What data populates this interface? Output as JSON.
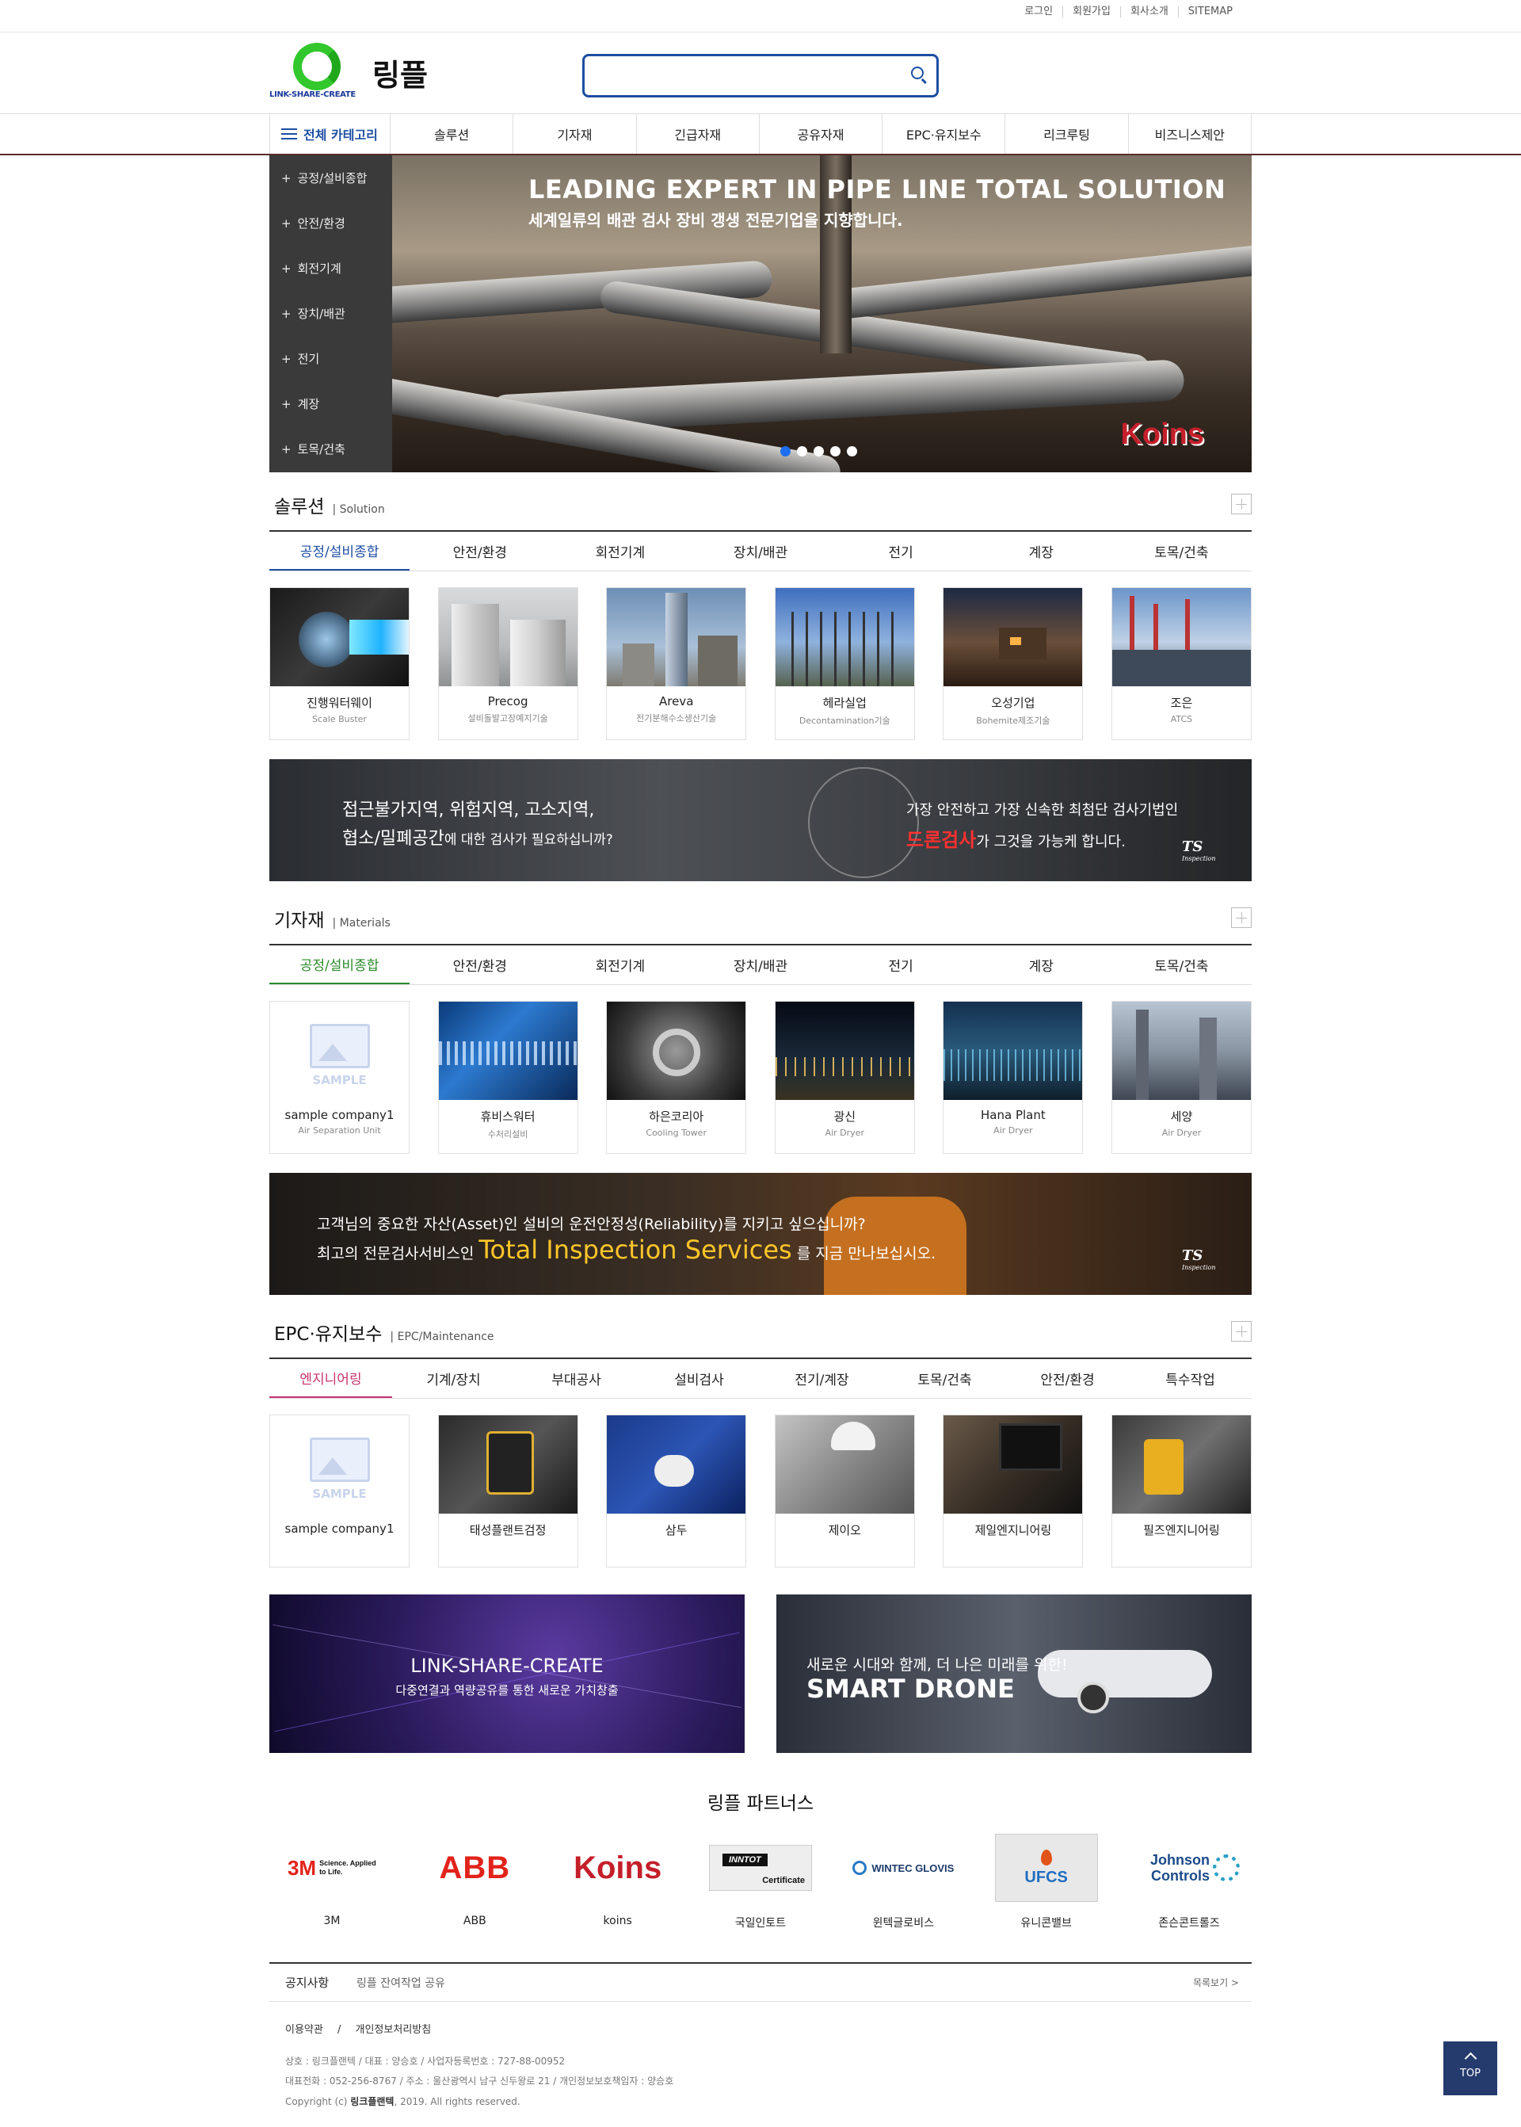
{
  "top_links": [
    "로그인",
    "회원가입",
    "회사소개",
    "SITEMAP"
  ],
  "header": {
    "brand": "링플",
    "logo_tagline": "LINK-SHARE-CREATE",
    "search_placeholder": ""
  },
  "nav": {
    "all_categories": "전체 카테고리",
    "items": [
      "솔루션",
      "기자재",
      "긴급자재",
      "공유자재",
      "EPC·유지보수",
      "리크루팅",
      "비즈니스제안"
    ]
  },
  "side_menu": [
    "공정/설비종합",
    "안전/환경",
    "회전기계",
    "장치/배관",
    "전기",
    "계장",
    "토목/건축"
  ],
  "hero": {
    "title": "LEADING EXPERT IN PIPE LINE TOTAL SOLUTION",
    "subtitle": "세계일류의 배관 검사 장비 갱생 전문기업을 지향합니다.",
    "brand": "Koins",
    "slides": 5,
    "active_slide": 1
  },
  "solution": {
    "title": "솔루션",
    "subtitle": "Solution",
    "tabs": [
      "공정/설비종합",
      "안전/환경",
      "회전기계",
      "장치/배관",
      "전기",
      "계장",
      "토목/건축"
    ],
    "cards": [
      {
        "name": "진행워터웨이",
        "desc": "Scale Buster"
      },
      {
        "name": "Precog",
        "desc": "설비돌발고장예지기술"
      },
      {
        "name": "Areva",
        "desc": "전기분해수소생산기술"
      },
      {
        "name": "헤라실업",
        "desc": "Decontamination기술"
      },
      {
        "name": "오성기업",
        "desc": "Bohemite제조기술"
      },
      {
        "name": "조은",
        "desc": "ATCS"
      }
    ]
  },
  "banner1": {
    "line1": "접근불가지역, 위험지역, 고소지역,",
    "line2_strong": "협소/밀폐공간",
    "line2_rest": "에 대한 검사가 필요하십니까?",
    "right1": "가장 안전하고 가장 신속한  최첨단 검사기법인",
    "right2_strong": "드론검사",
    "right2_rest": "가 그것을 가능케 합니다.",
    "logo": "TS",
    "logo_sub": "Inspection"
  },
  "materials": {
    "title": "기자재",
    "subtitle": "Materials",
    "tabs": [
      "공정/설비종합",
      "안전/환경",
      "회전기계",
      "장치/배관",
      "전기",
      "계장",
      "토목/건축"
    ],
    "cards": [
      {
        "name": "sample company1",
        "desc": "Air Separation Unit"
      },
      {
        "name": "휴비스워터",
        "desc": "수처리설비"
      },
      {
        "name": "하은코리아",
        "desc": "Cooling Tower"
      },
      {
        "name": "광신",
        "desc": "Air Dryer"
      },
      {
        "name": "Hana Plant",
        "desc": "Air Dryer"
      },
      {
        "name": "세양",
        "desc": "Air Dryer"
      }
    ]
  },
  "banner2": {
    "line1": "고객님의 중요한 자산(Asset)인 설비의 운전안정성(Reliability)를 지키고 싶으십니까?",
    "line2_a": "최고의 전문검사서비스인",
    "line2_b": "Total Inspection Services",
    "line2_c": "를 지금 만나보십시오.",
    "logo": "TS",
    "logo_sub": "Inspection"
  },
  "epc": {
    "title": "EPC·유지보수",
    "subtitle": "EPC/Maintenance",
    "tabs": [
      "엔지니어링",
      "기계/장치",
      "부대공사",
      "설비검사",
      "전기/계장",
      "토목/건축",
      "안전/환경",
      "특수작업"
    ],
    "cards": [
      {
        "name": "sample company1"
      },
      {
        "name": "태성플랜트검정"
      },
      {
        "name": "삼두"
      },
      {
        "name": "제이오"
      },
      {
        "name": "제일엔지니어링"
      },
      {
        "name": "필즈엔지니어링"
      }
    ]
  },
  "promo": {
    "left_title": "LINK-SHARE-CREATE",
    "left_sub": "다중연결과 역량공유를 통한 새로운 가치창출",
    "right_sub": "새로운 시대와 함께, 더 나은 미래를 위한!",
    "right_title": "SMART DRONE"
  },
  "partners": {
    "title": "링플 파트너스",
    "items": [
      {
        "logo": "3M",
        "logo_tag": "Science. Applied to Life.",
        "name": "3M"
      },
      {
        "logo": "ABB",
        "name": "ABB"
      },
      {
        "logo": "Koins",
        "name": "koins"
      },
      {
        "logo": "INNTOT",
        "logo_tag": "Certificate",
        "name": "국일인토트"
      },
      {
        "logo": "WINTEC GLOVIS",
        "name": "윈텍글로비스"
      },
      {
        "logo": "UFCS",
        "name": "유니콘밸브"
      },
      {
        "logo": "Johnson Controls",
        "name": "존슨콘트롤즈"
      }
    ]
  },
  "notice": {
    "label": "공지사항",
    "text": "링플 잔여작업 공유",
    "more": "목록보기 >"
  },
  "footer": {
    "links": [
      "이용약관",
      "개인정보처리방침"
    ],
    "sep": "/",
    "line1": "상호 : 링크플랜텍 / 대표 : 양승호 / 사업자등록번호 : 727-88-00952",
    "line2": "대표전화 : 052-256-8767 / 주소 : 울산광역시 남구 신두왕로 21 / 개인정보보호책임자 : 양승호",
    "line3_a": "Copyright (c)",
    "line3_b": "링크플랜텍",
    "line3_c": ", 2019. All rights reserved."
  },
  "top_button": "TOP",
  "colors": {
    "primary": "#1d4ea3",
    "materials_accent": "#2a8a2a",
    "epc_accent": "#c8326e",
    "sidebar": "#3a3a3a"
  }
}
